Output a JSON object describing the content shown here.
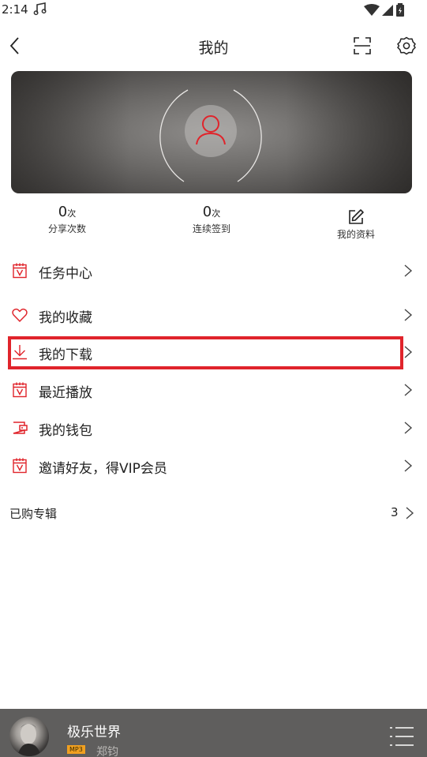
{
  "status": {
    "time": "2:14"
  },
  "header": {
    "title": "我的"
  },
  "stats": [
    {
      "value": "0",
      "unit": "次",
      "label": "分享次数"
    },
    {
      "value": "0",
      "unit": "次",
      "label": "连续签到"
    },
    {
      "label": "我的资料"
    }
  ],
  "menu": [
    {
      "label": "任务中心",
      "icon": "calendar-v-icon"
    },
    {
      "label": "我的收藏",
      "icon": "heart-icon"
    },
    {
      "label": "我的下载",
      "icon": "download-icon"
    },
    {
      "label": "最近播放",
      "icon": "calendar-v-icon"
    },
    {
      "label": "我的钱包",
      "icon": "wallet-icon"
    },
    {
      "label": "邀请好友，得VIP会员",
      "icon": "calendar-v-icon"
    }
  ],
  "purchased": {
    "label": "已购专辑",
    "count": "3"
  },
  "player": {
    "title": "极乐世界",
    "badge": "MP3",
    "artist": "郑钧"
  },
  "colors": {
    "accent": "#e0242b",
    "highlight": "#e0242b",
    "player_bg": "#5f5e5d"
  }
}
